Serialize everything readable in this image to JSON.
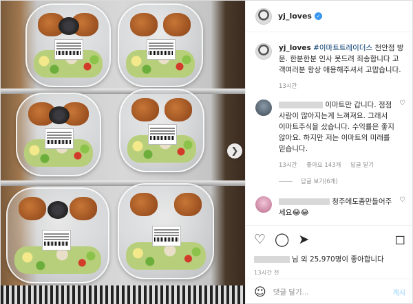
{
  "post": {
    "username": "yj_loves",
    "caption_username": "yj_loves",
    "caption_hashtag": "#이마트트레이더스",
    "caption_text": " 천안점 방문. 한분한분 인사 못드려 죄송합니다 고객여러분 항상 애용해주셔서 고맙습니다.",
    "caption_time": "13시간"
  },
  "comments": [
    {
      "text": "이마트만 갑니다. 점점 사람이 많아지는게 느껴져요. 그래서 이마트주식을 샀습니다. 수익률은 좋지 않아요. 하지만 저는 이마트의 미래를 믿습니다.",
      "time": "13시간",
      "likes": "좋아요 143개",
      "reply": "답글 달기",
      "view_replies": "답글 보기(6개)"
    },
    {
      "text": "청주에도좀만들어주세요😂😂"
    }
  ],
  "actions": {
    "likes_suffix": "님 외 25,970명이 좋아합니다",
    "timestamp": "13시간 전"
  },
  "composer": {
    "placeholder": "댓글 달기...",
    "post_label": "게시"
  }
}
